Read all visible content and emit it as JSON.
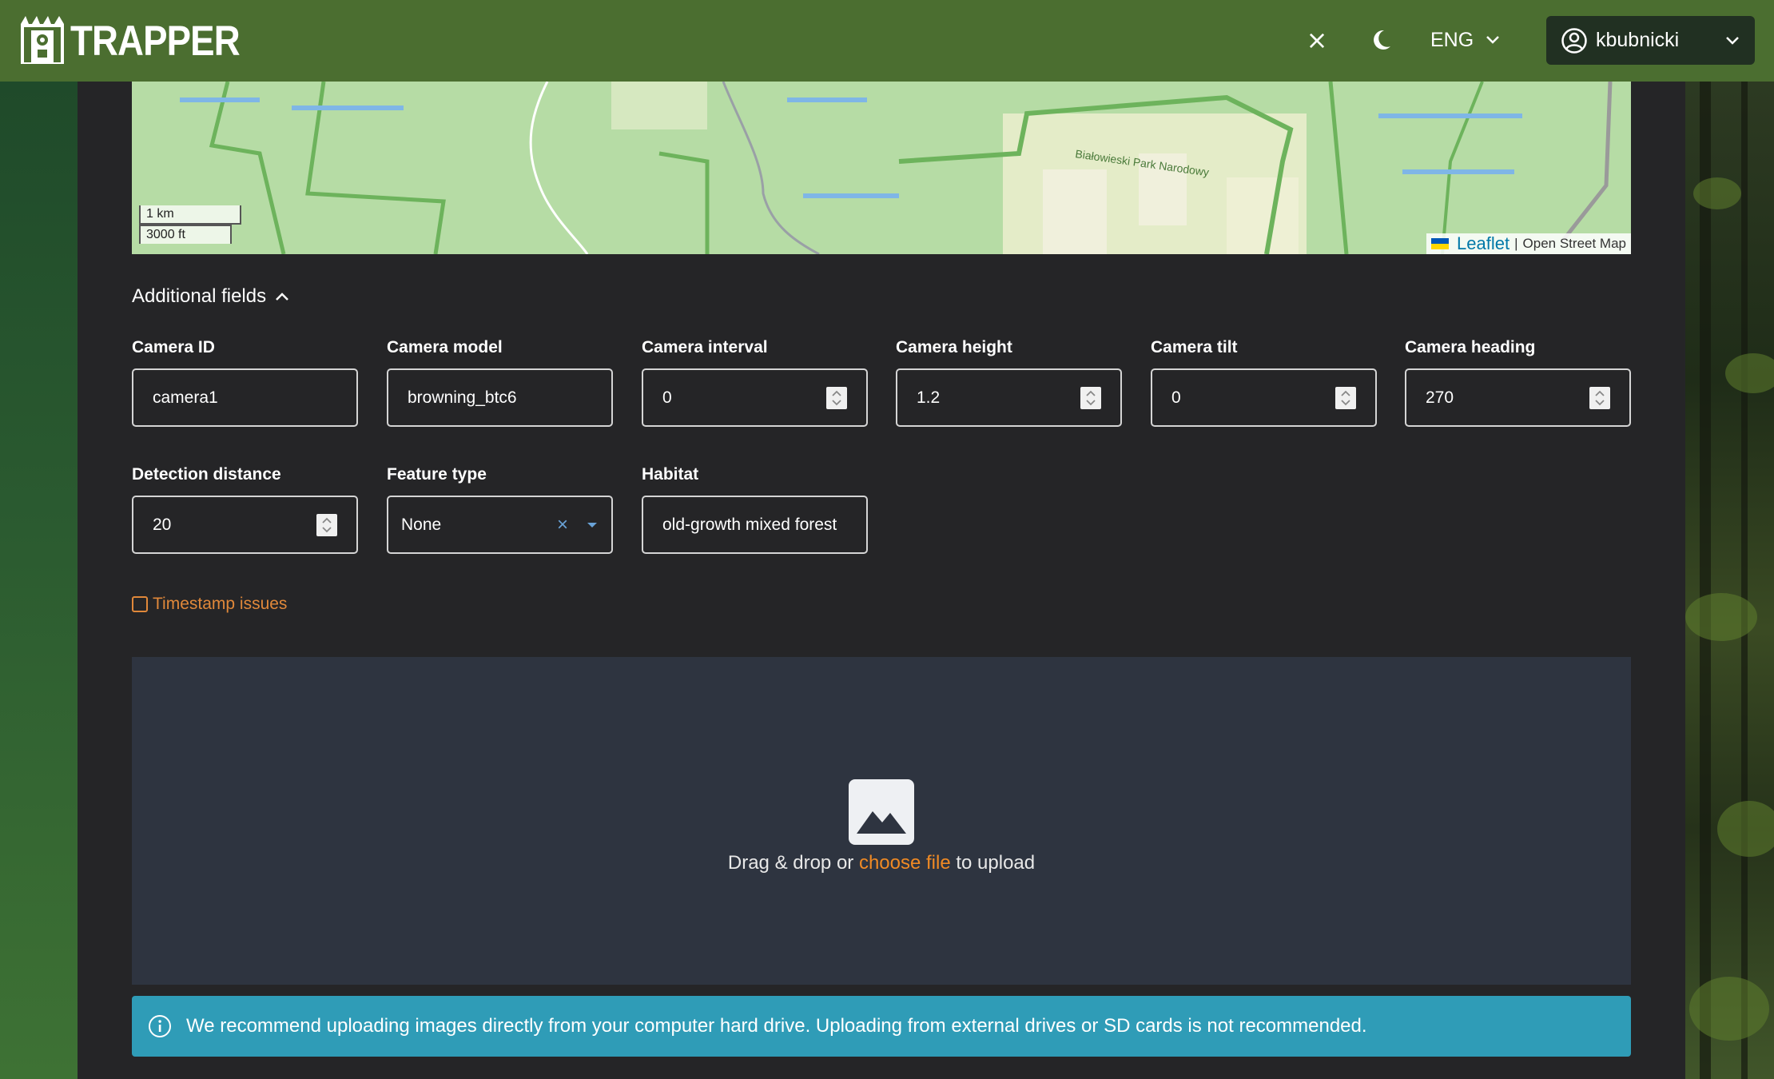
{
  "header": {
    "brand": "TRAPPER",
    "close_symbol": "×",
    "language": "ENG",
    "username": "kbubnicki"
  },
  "map": {
    "scale_metric": "1 km",
    "scale_imperial": "3000 ft",
    "park_label": "Białowieski Park Narodowy",
    "attribution_leaflet": "Leaflet",
    "attribution_sep": "|",
    "attribution_osm": "Open Street Map"
  },
  "form": {
    "additional_fields_label": "Additional fields",
    "fields": {
      "camera_id": {
        "label": "Camera ID",
        "value": "camera1"
      },
      "camera_model": {
        "label": "Camera model",
        "value": "browning_btc6"
      },
      "camera_interval": {
        "label": "Camera interval",
        "value": "0"
      },
      "camera_height": {
        "label": "Camera height",
        "value": "1.2"
      },
      "camera_tilt": {
        "label": "Camera tilt",
        "value": "0"
      },
      "camera_heading": {
        "label": "Camera heading",
        "value": "270"
      },
      "detection_distance": {
        "label": "Detection distance",
        "value": "20"
      },
      "feature_type": {
        "label": "Feature type",
        "value": "None",
        "clear_symbol": "×"
      },
      "habitat": {
        "label": "Habitat",
        "value": "old-growth mixed forest"
      }
    },
    "timestamp_issues_label": "Timestamp issues"
  },
  "upload": {
    "text_before": "Drag & drop or ",
    "link_text": "choose file",
    "text_after": " to upload"
  },
  "alert": {
    "text": "We recommend uploading images directly from your computer hard drive. Uploading from external drives or SD cards is not recommended."
  },
  "colors": {
    "header_bg": "#4b6e30",
    "page_bg": "#252527",
    "accent_orange": "#f08a24",
    "info_bg": "#2f9cb7",
    "dropzone_bg": "#2e3440"
  }
}
